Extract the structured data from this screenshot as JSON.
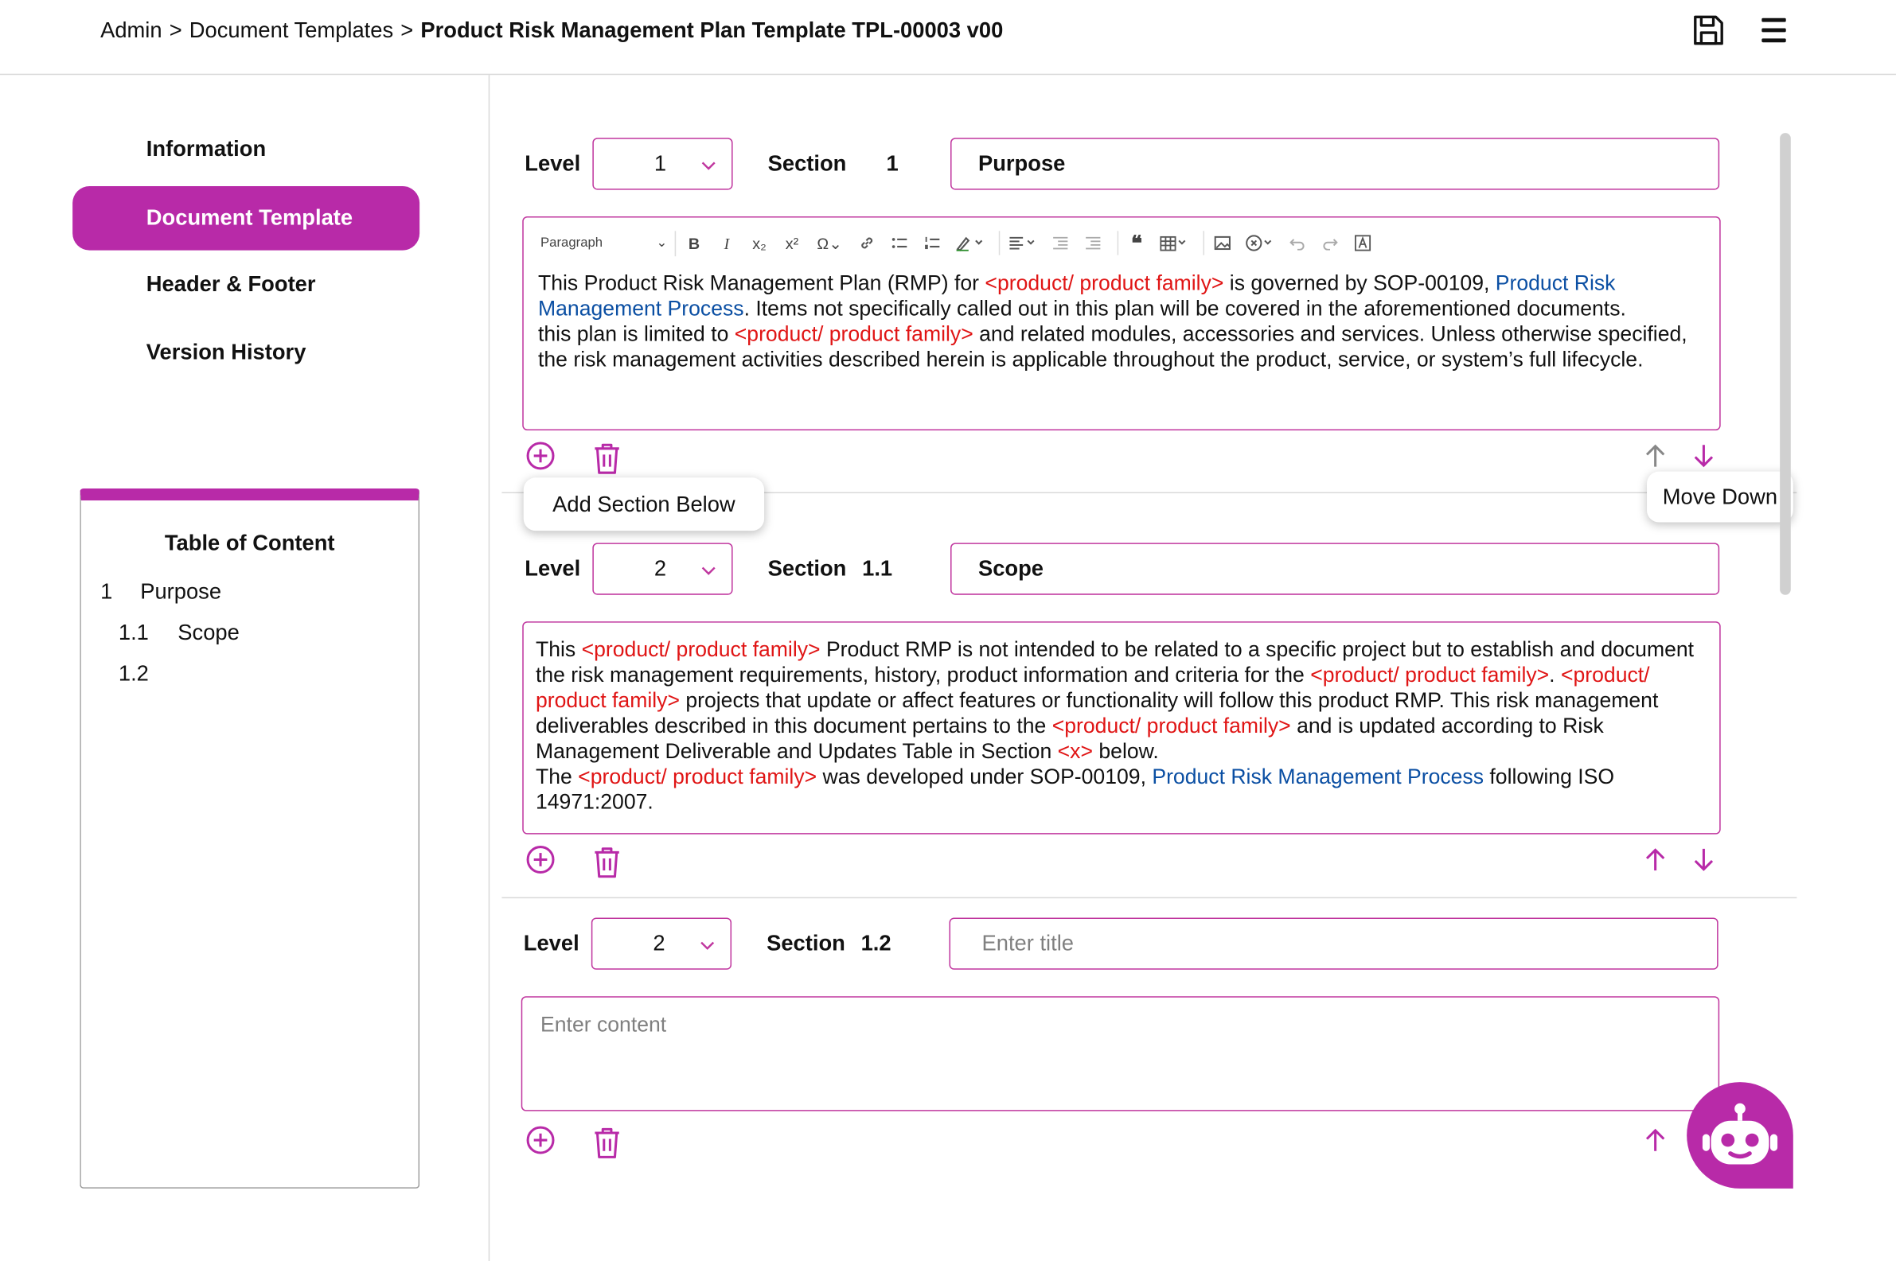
{
  "header": {
    "breadcrumb": [
      "Admin",
      "Document Templates"
    ],
    "separator": ">",
    "current_page": "Product Risk Management Plan Template TPL-00003 v00",
    "save_icon": "save-icon",
    "menu_icon": "hamburger-menu-icon"
  },
  "sidebar": {
    "items": [
      {
        "label": "Information",
        "active": false
      },
      {
        "label": "Document Template",
        "active": true
      },
      {
        "label": "Header & Footer",
        "active": false
      },
      {
        "label": "Version History",
        "active": false
      }
    ],
    "accent_color": "#b82aa8"
  },
  "toc": {
    "title": "Table of Content",
    "entries": [
      {
        "number": "1",
        "title": "Purpose"
      },
      {
        "number": "1.1",
        "title": "Scope"
      },
      {
        "number": "1.2",
        "title": ""
      }
    ]
  },
  "labels": {
    "level": "Level",
    "section": "Section"
  },
  "toolbar": {
    "paragraph_style": "Paragraph",
    "icons": [
      "bold-icon",
      "italic-icon",
      "subscript-icon",
      "superscript-icon",
      "special-characters-icon",
      "link-icon",
      "bulleted-list-icon",
      "numbered-list-icon",
      "highlight-icon",
      "align-icon",
      "outdent-icon",
      "indent-icon",
      "blockquote-icon",
      "table-icon",
      "image-icon",
      "remove-format-icon",
      "undo-icon",
      "redo-icon",
      "source-icon"
    ]
  },
  "sections": [
    {
      "level": "1",
      "number": "1",
      "title": "Purpose",
      "content": {
        "p1_a": "This Product Risk Management Plan (RMP) for ",
        "p1_ph": "<product/ product family>",
        "p1_b": " is governed by SOP-00109, ",
        "p1_link": "Product Risk Management Process",
        "p1_c": ". Items not specifically called out in this plan will be covered in the aforementioned documents.",
        "p2_a": "this plan is limited to ",
        "p2_ph": "<product/ product family>",
        "p2_b": " and related modules, accessories and services. Unless otherwise specified, the risk management activities described herein is applicable throughout the product, service, or system’s full lifecycle."
      }
    },
    {
      "level": "2",
      "number": "1.1",
      "title": "Scope",
      "content": {
        "p1_a": "This ",
        "p1_ph1": " <product/ product family>",
        "p1_b": " Product RMP is not intended to be related to a specific project but to establish and document the risk management requirements, history, product information and criteria for the ",
        "p1_ph2": " <product/ product family>",
        "p1_c": ". ",
        "p1_ph3": " <product/ product family>",
        "p1_d": " projects that update or affect features or functionality will follow this product RMP. This risk management deliverables described in this document pertains to the ",
        "p1_ph4": " <product/ product family>",
        "p1_e": " and is updated according to Risk Management Deliverable and Updates Table in Section ",
        "p1_ph5": "<x>",
        "p1_f": " below.",
        "p2_a": "The ",
        "p2_ph": " <product/ product family>",
        "p2_b": " was developed under SOP-00109, ",
        "p2_link": "Product Risk Management Process",
        "p2_c": " following ISO 14971:2007."
      }
    },
    {
      "level": "2",
      "number": "1.2",
      "title": "",
      "title_placeholder": "Enter title",
      "content_placeholder": "Enter content"
    }
  ],
  "tooltips": {
    "add_section": "Add Section Below",
    "move_down": "Move Down"
  },
  "colors": {
    "accent": "#b82aa8",
    "border": "#c0379f",
    "placeholder_text": "#e01515",
    "link": "#0b4fa3"
  },
  "assistant_icon": "robot-icon"
}
